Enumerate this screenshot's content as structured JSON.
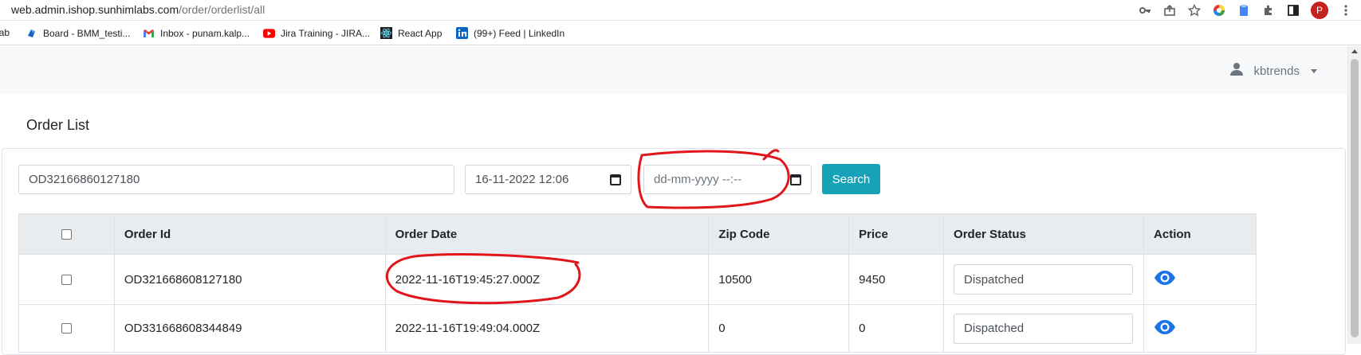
{
  "browser": {
    "url_host": "web.admin.ishop.sunhimlabs.com",
    "url_path": "/order/orderlist/all",
    "profile_initial": "P",
    "bookmarks": [
      {
        "label": "Tab",
        "icon": "tab-icon"
      },
      {
        "label": "Board - BMM_testi...",
        "icon": "board-icon"
      },
      {
        "label": "Inbox - punam.kalp...",
        "icon": "gmail-icon"
      },
      {
        "label": "Jira Training - JIRA...",
        "icon": "youtube-icon"
      },
      {
        "label": "React App",
        "icon": "react-icon"
      },
      {
        "label": "(99+) Feed | LinkedIn",
        "icon": "linkedin-icon"
      }
    ]
  },
  "header": {
    "user_name": "kbtrends"
  },
  "page": {
    "title": "Order List"
  },
  "filters": {
    "order_id_value": "OD32166860127180",
    "from_date_value": "16-11-2022 12:06",
    "to_date_placeholder": "dd-mm-yyyy --:--",
    "search_label": "Search"
  },
  "table": {
    "headers": [
      "Order Id",
      "Order Date",
      "Zip Code",
      "Price",
      "Order Status",
      "Action"
    ],
    "rows": [
      {
        "order_id": "OD321668608127180",
        "order_date": "2022-11-16T19:45:27.000Z",
        "zip": "10500",
        "price": "9450",
        "status": "Dispatched"
      },
      {
        "order_id": "OD331668608344849",
        "order_date": "2022-11-16T19:49:04.000Z",
        "zip": "0",
        "price": "0",
        "status": "Dispatched"
      }
    ]
  },
  "colors": {
    "accent": "#17a2b8",
    "annotation": "#e0161b",
    "eye_icon": "#1a73e8"
  }
}
